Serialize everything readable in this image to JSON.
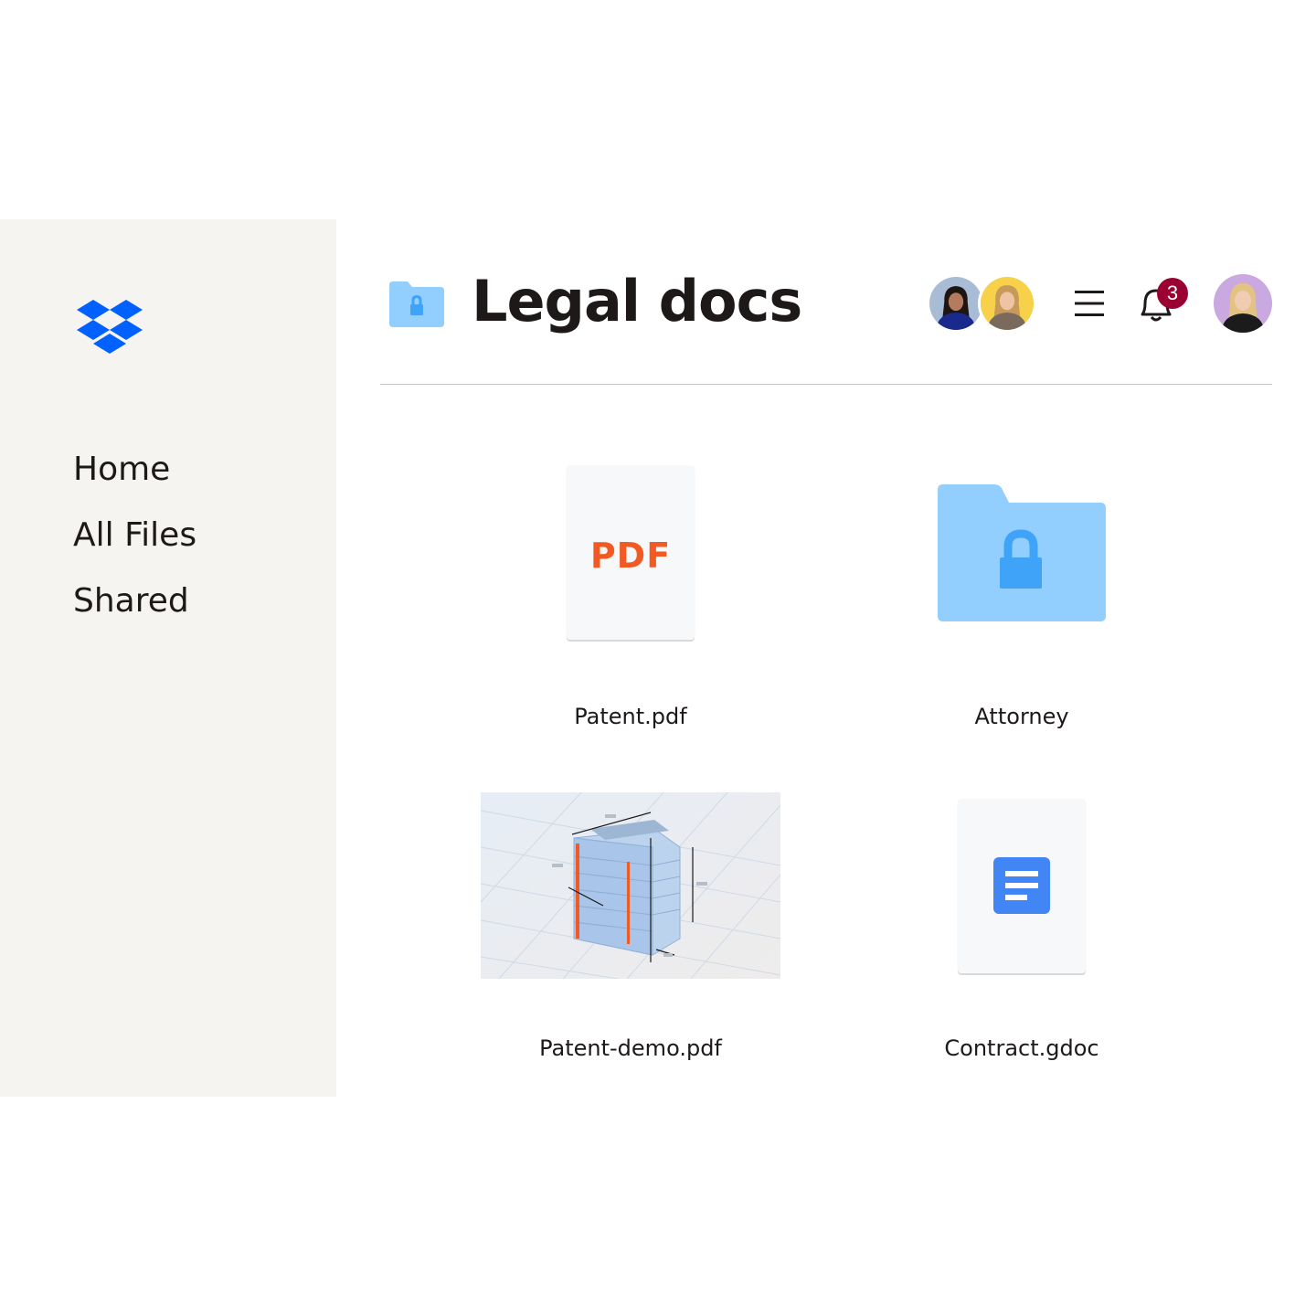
{
  "sidebar": {
    "logo_icon": "dropbox-logo-icon",
    "brand_color": "#0061fe",
    "nav": [
      {
        "label": "Home"
      },
      {
        "label": "All Files"
      },
      {
        "label": "Shared"
      }
    ]
  },
  "header": {
    "folder_icon": "locked-folder-icon",
    "title": "Legal docs",
    "collaborators": [
      "avatar-collaborator-1",
      "avatar-collaborator-2"
    ],
    "menu_icon": "hamburger-menu-icon",
    "notifications": {
      "icon": "bell-icon",
      "count": "3",
      "badge_color": "#9b0032"
    },
    "account_avatar": "avatar-current-user"
  },
  "files": [
    {
      "name": "Patent.pdf",
      "type": "pdf",
      "badge": "PDF",
      "accent": "#f15a22"
    },
    {
      "name": "Attorney",
      "type": "locked-folder",
      "accent": "#92cefe"
    },
    {
      "name": "Patent-demo.pdf",
      "type": "image-preview"
    },
    {
      "name": "Contract.gdoc",
      "type": "google-doc",
      "accent": "#4285f4"
    }
  ]
}
